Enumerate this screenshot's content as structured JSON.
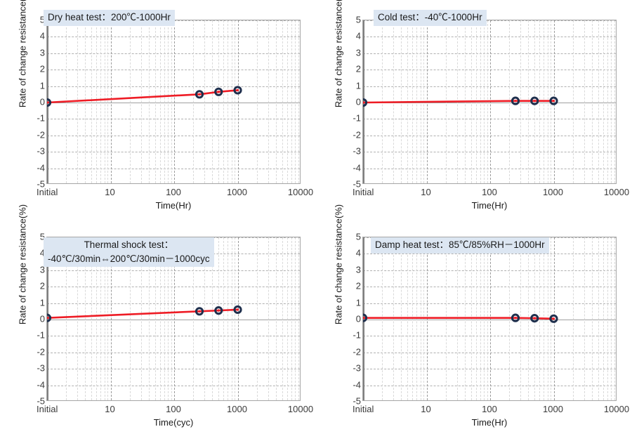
{
  "figure": {
    "panel_count": 4,
    "accent_line_color": "#ee1c25",
    "marker_ring_color": "#1f2f4d",
    "marker_core_color": "#ee1c25",
    "title_highlight_color": "#dce6f2",
    "grid_color": "#b0b0b0"
  },
  "axis": {
    "y_label": "Rate of change resistance(%)",
    "y_ticks": [
      "5",
      "4",
      "3",
      "2",
      "1",
      "0",
      "-1",
      "-2",
      "-3",
      "-4",
      "-5"
    ],
    "y_min": -5,
    "y_max": 5,
    "x_ticks": [
      "Initial",
      "10",
      "100",
      "1000",
      "10000"
    ],
    "x_scale": "log",
    "x_label_hr": "Time(Hr)",
    "x_label_cyc": "Time(cyc)"
  },
  "chart_data": [
    {
      "type": "line",
      "title": "Dry heat test：200℃-1000Hr",
      "title_lines": [
        "Dry heat test：200℃-1000Hr"
      ],
      "xlabel": "Time(Hr)",
      "ylabel": "Rate of change resistance(%)",
      "ylim": [
        -5,
        5
      ],
      "xticklabels": [
        "Initial",
        "10",
        "100",
        "1000",
        "10000"
      ],
      "grid": true,
      "legend": "none",
      "series": [
        {
          "name": "Rate of change resistance",
          "x": [
            "Initial",
            "250",
            "500",
            "1000"
          ],
          "y": [
            0.0,
            0.5,
            0.65,
            0.75
          ]
        }
      ]
    },
    {
      "type": "line",
      "title": "Cold test：-40℃-1000Hr",
      "title_lines": [
        "Cold test：-40℃-1000Hr"
      ],
      "xlabel": "Time(Hr)",
      "ylabel": "Rate of change resistance(%)",
      "ylim": [
        -5,
        5
      ],
      "xticklabels": [
        "Initial",
        "10",
        "100",
        "1000",
        "10000"
      ],
      "grid": true,
      "legend": "none",
      "series": [
        {
          "name": "Rate of change resistance",
          "x": [
            "Initial",
            "250",
            "500",
            "1000"
          ],
          "y": [
            0.0,
            0.1,
            0.1,
            0.1
          ]
        }
      ]
    },
    {
      "type": "line",
      "title": "Thermal shock test： -40℃/30min⇔200℃/30min－1000cyc",
      "title_lines": [
        "Thermal shock test：",
        "-40℃/30min⇔200℃/30min－1000cyc"
      ],
      "xlabel": "Time(cyc)",
      "ylabel": "Rate of change resistance(%)",
      "ylim": [
        -5,
        5
      ],
      "xticklabels": [
        "Initial",
        "10",
        "100",
        "1000",
        "10000"
      ],
      "grid": true,
      "legend": "none",
      "series": [
        {
          "name": "Rate of change resistance",
          "x": [
            "Initial",
            "250",
            "500",
            "1000"
          ],
          "y": [
            0.1,
            0.5,
            0.55,
            0.6
          ]
        }
      ]
    },
    {
      "type": "line",
      "title": "Damp heat test：85℃/85%RH－1000Hr",
      "title_lines": [
        "Damp heat test：85℃/85%RH－1000Hr"
      ],
      "xlabel": "Time(Hr)",
      "ylabel": "Rate of change resistance(%)",
      "ylim": [
        -5,
        5
      ],
      "xticklabels": [
        "Initial",
        "10",
        "100",
        "1000",
        "10000"
      ],
      "grid": true,
      "legend": "none",
      "series": [
        {
          "name": "Rate of change resistance",
          "x": [
            "Initial",
            "250",
            "500",
            "1000"
          ],
          "y": [
            0.1,
            0.1,
            0.08,
            0.05
          ]
        }
      ]
    }
  ]
}
